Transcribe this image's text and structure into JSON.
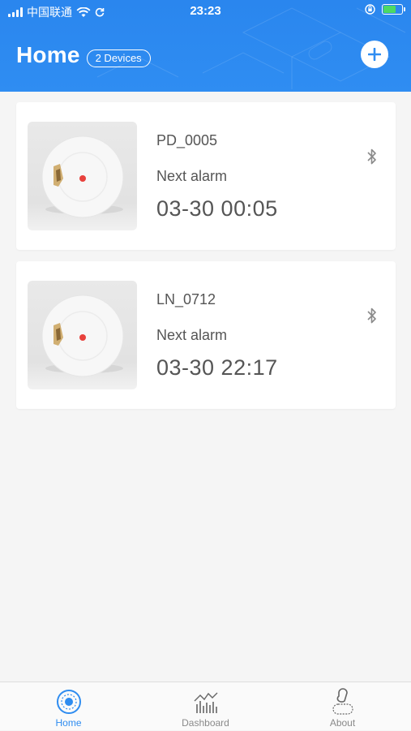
{
  "status_bar": {
    "carrier": "中国联通",
    "time": "23:23"
  },
  "header": {
    "title": "Home",
    "device_count_label": "2 Devices"
  },
  "devices": [
    {
      "name": "PD_0005",
      "alarm_label": "Next alarm",
      "alarm_time": "03-30 00:05"
    },
    {
      "name": "LN_0712",
      "alarm_label": "Next alarm",
      "alarm_time": "03-30 22:17"
    }
  ],
  "tabbar": {
    "items": [
      {
        "label": "Home",
        "icon": "home-target-icon",
        "active": true
      },
      {
        "label": "Dashboard",
        "icon": "dashboard-chart-icon",
        "active": false
      },
      {
        "label": "About",
        "icon": "about-person-icon",
        "active": false
      }
    ]
  },
  "colors": {
    "header_blue": "#2f8df2",
    "accent": "#2e8cf0",
    "text_gray": "#555555",
    "battery_green": "#4cd964"
  }
}
